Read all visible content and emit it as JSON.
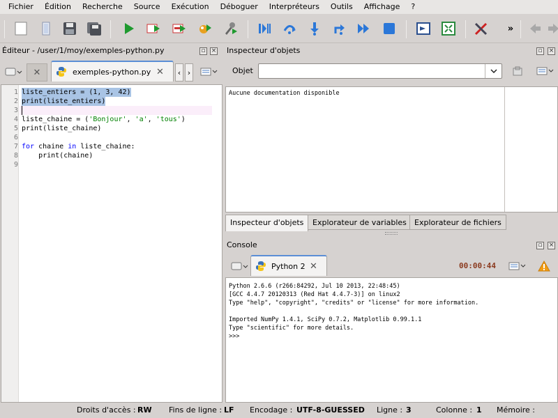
{
  "menu": [
    "Fichier",
    "Édition",
    "Recherche",
    "Source",
    "Exécution",
    "Déboguer",
    "Interpréteurs",
    "Outils",
    "Affichage",
    "?"
  ],
  "toolbar": {
    "icons": [
      "new-file-icon",
      "open-file-icon",
      "save-icon",
      "save-all-icon",
      "run-icon",
      "run-config-icon",
      "run-selection-icon",
      "debug-icon",
      "profile-icon",
      "debug-start-icon",
      "step-icon",
      "step-into-icon",
      "step-return-icon",
      "continue-icon",
      "stop-icon",
      "maximize-icon",
      "python-path-icon",
      "preferences-icon",
      "more-icon",
      "back-icon"
    ],
    "more_label": "»"
  },
  "editor": {
    "title": "Éditeur - /user/1/moy/exemples-python.py",
    "tab_label": "exemples-python.py",
    "code_lines": [
      {
        "n": "1",
        "segments": [
          {
            "t": "liste_entiers = (1, 3, 42)",
            "c": ""
          }
        ],
        "selected": true
      },
      {
        "n": "2",
        "segments": [
          {
            "t": "print(liste_entiers)",
            "c": ""
          }
        ],
        "selected": true
      },
      {
        "n": "3",
        "segments": [],
        "current": true
      },
      {
        "n": "4",
        "segments": [
          {
            "t": "liste_chaine = (",
            "c": ""
          },
          {
            "t": "'Bonjour'",
            "c": "str"
          },
          {
            "t": ", ",
            "c": ""
          },
          {
            "t": "'a'",
            "c": "str"
          },
          {
            "t": ", ",
            "c": ""
          },
          {
            "t": "'tous'",
            "c": "str"
          },
          {
            "t": ")",
            "c": ""
          }
        ]
      },
      {
        "n": "5",
        "segments": [
          {
            "t": "print(liste_chaine)",
            "c": ""
          }
        ]
      },
      {
        "n": "6",
        "segments": []
      },
      {
        "n": "7",
        "segments": [
          {
            "t": "for",
            "c": "kw"
          },
          {
            "t": " chaine ",
            "c": ""
          },
          {
            "t": "in",
            "c": "kw"
          },
          {
            "t": " liste_chaine:",
            "c": ""
          }
        ]
      },
      {
        "n": "8",
        "segments": [
          {
            "t": "    print(chaine)",
            "c": ""
          }
        ]
      },
      {
        "n": "9",
        "segments": []
      }
    ]
  },
  "inspector": {
    "title": "Inspecteur d'objets",
    "object_label": "Objet",
    "object_value": "",
    "doc_text": "Aucune documentation disponible",
    "tabs": [
      "Inspecteur d'objets",
      "Explorateur de variables",
      "Explorateur de fichiers"
    ]
  },
  "console": {
    "title": "Console",
    "tab_label": "Python 2",
    "timer": "00:00:44",
    "lines": [
      "Python 2.6.6 (r266:84292, Jul 10 2013, 22:48:45)",
      "[GCC 4.4.7 20120313 (Red Hat 4.4.7-3)] on linux2",
      "Type \"help\", \"copyright\", \"credits\" or \"license\" for more information.",
      "",
      "Imported NumPy 1.4.1, SciPy 0.7.2, Matplotlib 0.99.1.1",
      "Type \"scientific\" for more details.",
      ">>>"
    ]
  },
  "status": {
    "access_label": "Droits d'accès :",
    "access_value": "RW",
    "eol_label": "Fins de ligne :",
    "eol_value": "LF",
    "encoding_label": "Encodage :",
    "encoding_value": "UTF-8-GUESSED",
    "line_label": "Ligne :",
    "line_value": "3",
    "col_label": "Colonne :",
    "col_value": "1",
    "memory_label": "Mémoire :"
  },
  "colors": {
    "accent": "#5b8ed6",
    "selection": "#a9c4e5",
    "timer": "#8b3a1e"
  }
}
